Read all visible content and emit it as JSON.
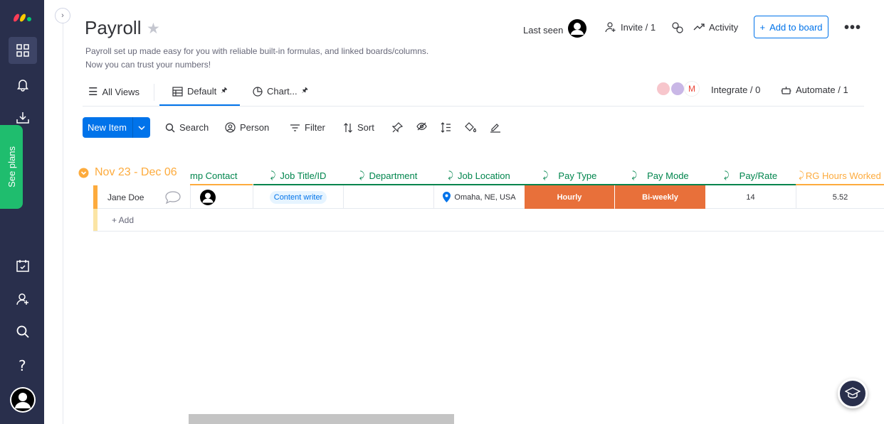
{
  "board": {
    "title": "Payroll",
    "description_line1": "Payroll set up made easy for you with reliable built-in formulas, and linked boards/columns.",
    "description_line2": "Now you can trust your numbers!"
  },
  "header": {
    "last_seen": "Last seen",
    "invite": "Invite / 1",
    "activity": "Activity",
    "add_to_board": "Add to board"
  },
  "sidebar": {
    "see_plans": "See plans"
  },
  "tabs": [
    {
      "label": "All Views"
    },
    {
      "label": "Default"
    },
    {
      "label": "Chart..."
    }
  ],
  "integrations": {
    "integrate": "Integrate / 0",
    "automate": "Automate / 1"
  },
  "toolbar": {
    "new_item": "New Item",
    "search": "Search",
    "person": "Person",
    "filter": "Filter",
    "sort": "Sort"
  },
  "group": {
    "title": "Nov 23 - Dec 06",
    "color": "#fdab3d"
  },
  "columns": [
    {
      "label": "mp Contact"
    },
    {
      "label": "Job Title/ID"
    },
    {
      "label": "Department"
    },
    {
      "label": "Job Location"
    },
    {
      "label": "Pay Type"
    },
    {
      "label": "Pay Mode"
    },
    {
      "label": "Pay/Rate"
    },
    {
      "label": "RG Hours Worked"
    }
  ],
  "rows": [
    {
      "name": "Jane Doe",
      "job_title": "Content writer",
      "department": "",
      "location": "Omaha, NE, USA",
      "pay_type": "Hourly",
      "pay_mode": "Bi-weekly",
      "pay_rate": "14",
      "rg_hours": "5.52"
    }
  ],
  "add_row": "+ Add",
  "colors": {
    "accent": "#0073ea",
    "rail": "#292f4c",
    "status_orange": "#e8703a",
    "formula_green": "#00854d"
  }
}
